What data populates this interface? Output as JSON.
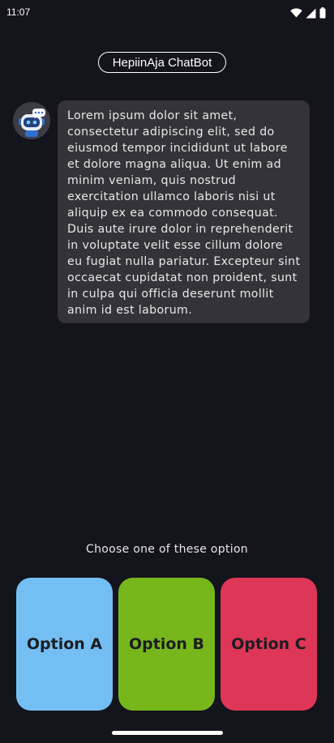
{
  "status_bar": {
    "time": "11:07",
    "icons": [
      "wifi-icon",
      "signal-icon",
      "battery-icon"
    ]
  },
  "header": {
    "title": "HepiinAja ChatBot"
  },
  "chat": {
    "messages": [
      {
        "sender": "bot",
        "avatar_icon": "robot-icon",
        "text": "Lorem ipsum dolor sit amet, consectetur adipiscing elit, sed do eiusmod tempor incididunt ut labore et dolore magna aliqua. Ut enim ad minim veniam, quis nostrud exercitation ullamco laboris nisi ut aliquip ex ea commodo consequat. Duis aute irure dolor in reprehenderit in voluptate velit esse cillum dolore eu fugiat nulla pariatur. Excepteur sint occaecat cupidatat non proident, sunt in culpa qui officia deserunt mollit anim id est laborum."
      }
    ]
  },
  "options": {
    "prompt": "Choose one of these option",
    "items": [
      {
        "label": "Option A",
        "color": "#73bff3"
      },
      {
        "label": "Option B",
        "color": "#77b71c"
      },
      {
        "label": "Option C",
        "color": "#dd3656"
      }
    ]
  },
  "colors": {
    "background": "#14141c",
    "bubble": "#333339"
  }
}
